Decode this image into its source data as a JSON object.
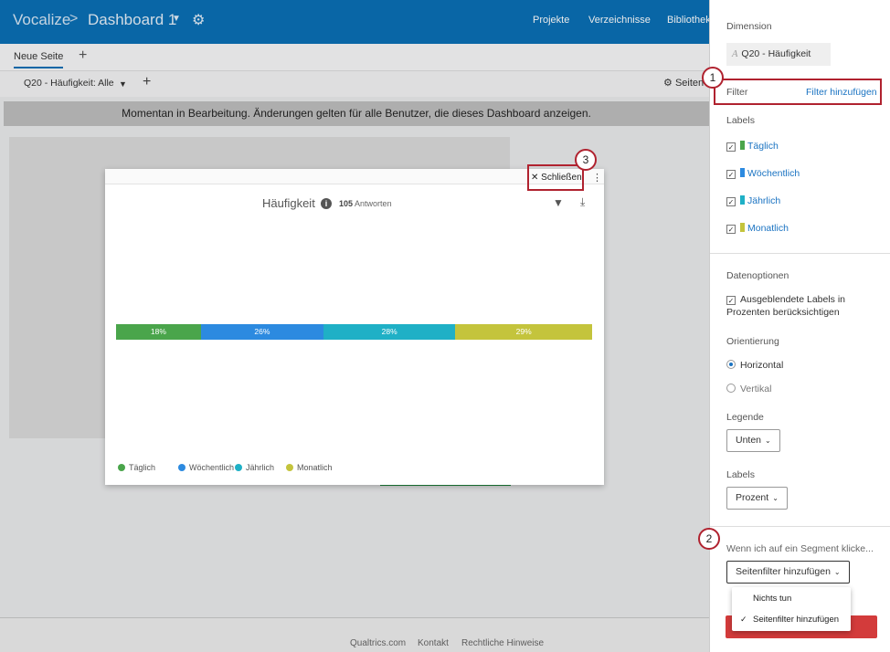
{
  "header": {
    "brand": "Vocalize",
    "dashboard_name": "Dashboard 1",
    "nav": [
      "Projekte",
      "Verzeichnisse",
      "Bibliothek"
    ]
  },
  "page_tabs": {
    "active": "Neue Seite"
  },
  "filter_bar": {
    "chip": "Q20 - Häufigkeit: Alle",
    "page_settings": "Seiten"
  },
  "banner": "Momentan in Bearbeitung. Änderungen gelten für alle Benutzer, die dieses Dashboard anzeigen.",
  "footer": [
    "Qualtrics.com",
    "Kontakt",
    "Rechtliche Hinweise"
  ],
  "widget": {
    "close_label": "Schließen",
    "title": "Häufigkeit",
    "responses_count": "105",
    "responses_label": "Antworten"
  },
  "chart_data": {
    "type": "bar",
    "orientation": "horizontal-stacked",
    "categories": [
      "Täglich",
      "Wöchentlich",
      "Jährlich",
      "Monatlich"
    ],
    "values": [
      18,
      26,
      28,
      29
    ],
    "labels": [
      "18%",
      "26%",
      "28%",
      "29%"
    ],
    "colors": [
      "#4aa54b",
      "#2c8ae0",
      "#1fb0c6",
      "#c4c43c"
    ],
    "legend_position": "bottom"
  },
  "panel": {
    "dimension_label": "Dimension",
    "dimension_value": "Q20 - Häufigkeit",
    "filter_label": "Filter",
    "filter_link": "Filter hinzufügen",
    "labels_heading": "Labels",
    "label_items": [
      "Täglich",
      "Wöchentlich",
      "Jährlich",
      "Monatlich"
    ],
    "data_options_heading": "Datenoptionen",
    "hidden_labels_option": [
      "Ausgeblendete Labels in",
      "Prozenten berücksichtigen"
    ],
    "orientation_heading": "Orientierung",
    "orientation_options": [
      "Horizontal",
      "Vertikal"
    ],
    "legend_heading": "Legende",
    "legend_value": "Unten",
    "labels2_heading": "Labels",
    "labels2_value": "Prozent",
    "segment_click_label": "Wenn ich auf ein Segment klicke...",
    "segment_select_value": "Seitenfilter hinzufügen",
    "dropdown_options": [
      "Nichts tun",
      "Seitenfilter hinzufügen"
    ]
  },
  "annotations": [
    "1",
    "2",
    "3"
  ],
  "colors": {
    "topbar": "#0a6fb5",
    "link": "#1a73c2",
    "callout": "#b0222f",
    "primary_button": "#d33b3b"
  }
}
